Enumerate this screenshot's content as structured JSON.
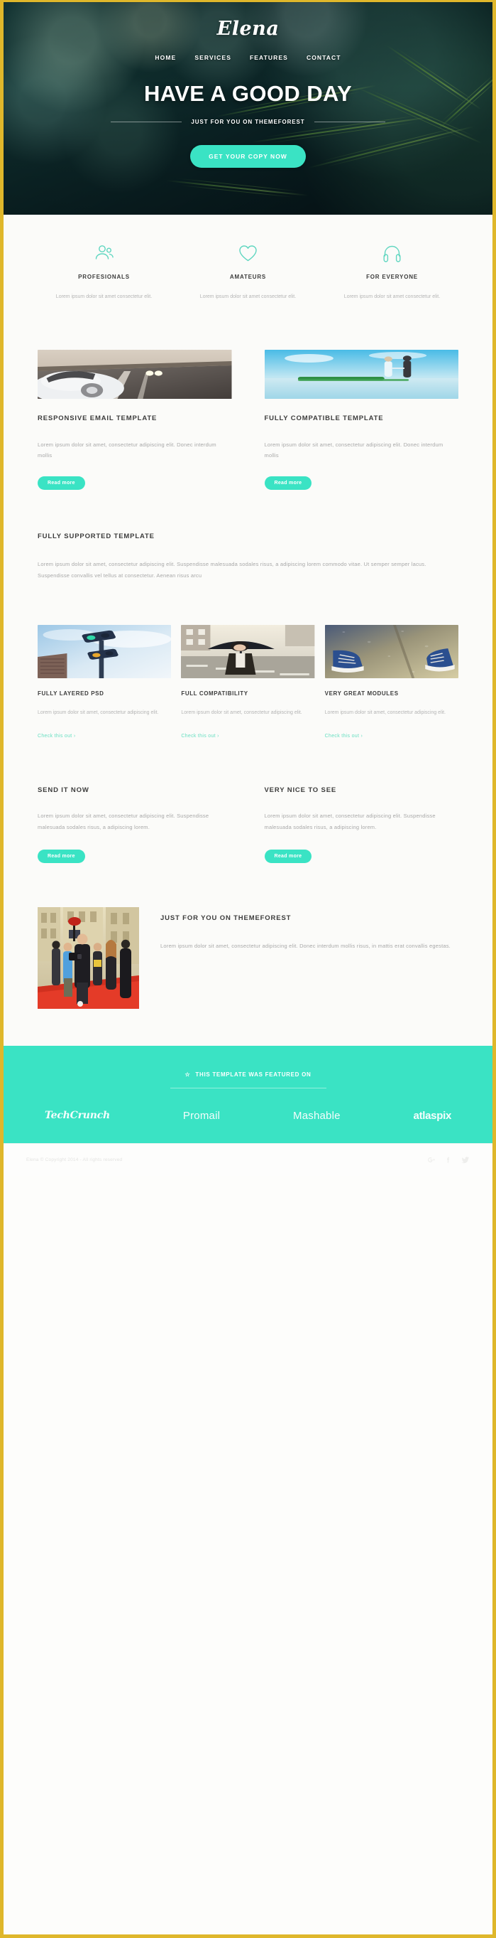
{
  "theme": {
    "accent_mint": "#3ae3c4",
    "frame_gold": "#dfb72b",
    "heading_dark": "#3c3c3c",
    "body_grey": "#b5b5b5",
    "link_mint": "#69dfc2"
  },
  "hero": {
    "logo": "Elena",
    "nav": [
      {
        "label": "HOME"
      },
      {
        "label": "SERVICES"
      },
      {
        "label": "FEATURES"
      },
      {
        "label": "CONTACT"
      }
    ],
    "title": "HAVE A GOOD DAY",
    "subtitle": "JUST FOR YOU ON THEMEFOREST",
    "cta_label": "GET YOUR COPY NOW"
  },
  "features": [
    {
      "icon": "people-icon",
      "title": "PROFESIONALS",
      "text": "Lorem ipsum dolor sit amet consectetur elit."
    },
    {
      "icon": "heart-icon",
      "title": "AMATEURS",
      "text": "Lorem ipsum dolor sit amet consectetur elit."
    },
    {
      "icon": "headphones-icon",
      "title": "FOR EVERYONE",
      "text": "Lorem ipsum dolor sit amet consectetur elit."
    }
  ],
  "media_cards": [
    {
      "image": "vintage-car-on-road-photo",
      "title": "RESPONSIVE EMAIL TEMPLATE",
      "text": "Lorem ipsum dolor sit amet, consectetur adipiscing elit. Donec interdum mollis",
      "button": "Read more"
    },
    {
      "image": "couple-on-beach-photo",
      "title": "FULLY COMPATIBLE TEMPLATE",
      "text": "Lorem ipsum dolor sit amet, consectetur adipiscing elit. Donec interdum mollis",
      "button": "Read more"
    }
  ],
  "supported": {
    "title": "FULLY SUPPORTED TEMPLATE",
    "text": "Lorem ipsum dolor sit amet, consectetur adipiscing elit. Suspendisse malesuada sodales risus, a adipiscing lorem commodo vitae. Ut semper semper lacus. Suspendisse convallis vel tellus at consectetur. Aenean risus arcu"
  },
  "gallery": [
    {
      "image": "traffic-light-sky-photo",
      "title": "FULLY LAYERED PSD",
      "text": "Lorem ipsum dolor sit amet, consectetur adipiscing elit.",
      "link": "Check this out",
      "link_arrow": "›"
    },
    {
      "image": "woman-with-umbrella-photo",
      "title": "FULL COMPATIBILITY",
      "text": "Lorem ipsum dolor sit amet, consectetur adipiscing elit.",
      "link": "Check this out",
      "link_arrow": "›"
    },
    {
      "image": "sneakers-on-pavement-photo",
      "title": "VERY GREAT MODULES",
      "text": "Lorem ipsum dolor sit amet, consectetur adipiscing elit.",
      "link": "Check this out",
      "link_arrow": "›"
    }
  ],
  "text_blocks": [
    {
      "title": "SEND IT NOW",
      "text": "Lorem ipsum dolor sit amet, consectetur adipiscing elit. Suspendisse malesuada sodales risus, a adipiscing lorem.",
      "button": "Read more"
    },
    {
      "title": "VERY NICE TO SEE",
      "text": "Lorem ipsum dolor sit amet, consectetur adipiscing elit. Suspendisse malesuada sodales risus, a adipiscing lorem.",
      "button": "Read more"
    }
  ],
  "split": {
    "image": "red-carpet-crowd-photo",
    "title": "JUST FOR YOU ON THEMEFOREST",
    "text": "Lorem ipsum dolor sit amet, consectetur adipiscing elit. Donec interdum mollis risus, in mattis erat convallis egestas."
  },
  "footer": {
    "featured_star": "☆",
    "featured_label": "THIS TEMPLATE WAS FEATURED ON",
    "brands": [
      {
        "name": "TechCrunch",
        "style": "script"
      },
      {
        "name": "Promail",
        "style": "light"
      },
      {
        "name": "Mashable",
        "style": "light"
      },
      {
        "name": "atlaspix",
        "style": "bold"
      }
    ],
    "copyright": "Elena © Copyright 2014 - All rights reserved",
    "socials": [
      {
        "icon": "google-plus-icon"
      },
      {
        "icon": "facebook-icon"
      },
      {
        "icon": "twitter-icon"
      }
    ]
  }
}
